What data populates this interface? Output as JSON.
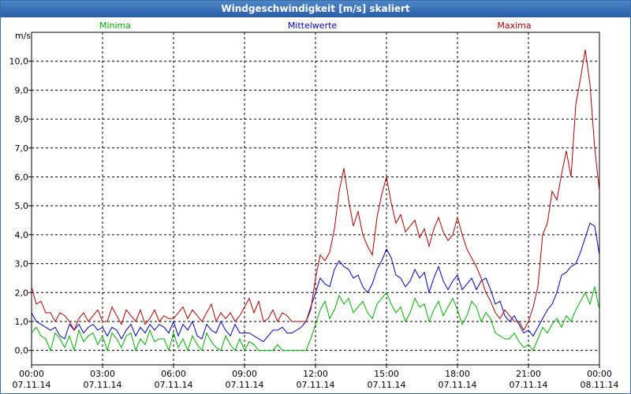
{
  "window": {
    "title": "Windgeschwindigkeit [m/s] skaliert"
  },
  "chart_data": {
    "type": "line",
    "title": "Windgeschwindigkeit [m/s] skaliert",
    "ylabel": "m/s",
    "xlabel": "",
    "ylim": [
      -0.5,
      11.0
    ],
    "xlim": [
      0,
      24
    ],
    "grid": true,
    "legend_placement": "top",
    "y_ticks": [
      "0,0",
      "1,0",
      "2,0",
      "3,0",
      "4,0",
      "5,0",
      "6,0",
      "7,0",
      "8,0",
      "9,0",
      "10,0"
    ],
    "x_ticks": [
      {
        "time": "00:00",
        "date": "07.11.14"
      },
      {
        "time": "03:00",
        "date": "07.11.14"
      },
      {
        "time": "06:00",
        "date": "07.11.14"
      },
      {
        "time": "09:00",
        "date": "07.11.14"
      },
      {
        "time": "12:00",
        "date": "07.11.14"
      },
      {
        "time": "15:00",
        "date": "07.11.14"
      },
      {
        "time": "18:00",
        "date": "07.11.14"
      },
      {
        "time": "21:00",
        "date": "07.11.14"
      },
      {
        "time": "00:00",
        "date": "08.11.14"
      }
    ],
    "x_hours": [
      0.0,
      0.2,
      0.4,
      0.6,
      0.8,
      1.0,
      1.2,
      1.4,
      1.6,
      1.8,
      2.0,
      2.2,
      2.4,
      2.6,
      2.8,
      3.0,
      3.2,
      3.4,
      3.6,
      3.8,
      4.0,
      4.2,
      4.4,
      4.6,
      4.8,
      5.0,
      5.2,
      5.4,
      5.6,
      5.8,
      6.0,
      6.2,
      6.4,
      6.6,
      6.8,
      7.0,
      7.2,
      7.4,
      7.6,
      7.8,
      8.0,
      8.2,
      8.4,
      8.6,
      8.8,
      9.0,
      9.2,
      9.4,
      9.6,
      9.8,
      10.0,
      10.2,
      10.4,
      10.6,
      10.8,
      11.0,
      11.2,
      11.4,
      11.6,
      11.8,
      12.0,
      12.2,
      12.4,
      12.6,
      12.8,
      13.0,
      13.2,
      13.4,
      13.6,
      13.8,
      14.0,
      14.2,
      14.4,
      14.6,
      14.8,
      15.0,
      15.2,
      15.4,
      15.6,
      15.8,
      16.0,
      16.2,
      16.4,
      16.6,
      16.8,
      17.0,
      17.2,
      17.4,
      17.6,
      17.8,
      18.0,
      18.2,
      18.4,
      18.6,
      18.8,
      19.0,
      19.2,
      19.4,
      19.6,
      19.8,
      20.0,
      20.2,
      20.4,
      20.6,
      20.8,
      21.0,
      21.2,
      21.4,
      21.6,
      21.8,
      22.0,
      22.2,
      22.4,
      22.6,
      22.8,
      23.0,
      23.2,
      23.4,
      23.6,
      23.8,
      24.0
    ],
    "series": [
      {
        "name": "Minima",
        "color": "#00b000",
        "values": [
          0.6,
          0.8,
          0.5,
          0.4,
          0.0,
          0.6,
          0.4,
          0.1,
          0.5,
          0.0,
          0.7,
          0.3,
          0.5,
          0.6,
          0.2,
          0.5,
          0.0,
          0.6,
          0.4,
          0.1,
          0.5,
          0.6,
          0.0,
          0.4,
          0.2,
          0.7,
          0.3,
          0.4,
          0.4,
          0.0,
          0.6,
          0.1,
          0.4,
          0.0,
          0.5,
          0.2,
          0.0,
          0.6,
          0.3,
          0.1,
          0.0,
          0.5,
          0.2,
          0.0,
          0.4,
          0.0,
          0.3,
          0.2,
          0.0,
          0.0,
          0.0,
          0.0,
          0.2,
          0.0,
          0.0,
          0.0,
          0.0,
          0.0,
          0.0,
          0.4,
          0.9,
          1.4,
          1.7,
          1.1,
          1.4,
          1.9,
          1.6,
          1.8,
          1.3,
          1.5,
          1.7,
          1.3,
          1.1,
          1.6,
          1.8,
          2.0,
          1.6,
          1.3,
          1.5,
          1.0,
          1.3,
          1.8,
          1.5,
          1.6,
          1.0,
          1.4,
          1.7,
          1.2,
          1.5,
          1.8,
          1.4,
          0.9,
          1.2,
          1.7,
          1.5,
          1.0,
          1.3,
          1.1,
          0.6,
          0.5,
          0.4,
          0.4,
          0.6,
          0.3,
          0.1,
          0.2,
          0.0,
          0.4,
          0.8,
          0.6,
          0.9,
          1.1,
          0.8,
          1.2,
          1.0,
          1.4,
          1.7,
          2.0,
          1.6,
          2.2,
          1.4
        ]
      },
      {
        "name": "Mittelwerte",
        "color": "#0000c0",
        "values": [
          1.3,
          1.0,
          0.9,
          0.8,
          0.7,
          0.8,
          0.5,
          0.4,
          0.9,
          0.7,
          0.9,
          0.6,
          0.8,
          0.9,
          0.7,
          0.8,
          0.5,
          0.8,
          0.7,
          0.4,
          0.7,
          0.9,
          0.5,
          0.8,
          0.6,
          0.9,
          0.7,
          0.9,
          0.8,
          0.6,
          1.0,
          0.5,
          0.9,
          0.7,
          1.0,
          0.5,
          0.4,
          0.9,
          0.7,
          0.6,
          1.0,
          0.7,
          0.5,
          0.9,
          0.6,
          0.6,
          0.6,
          0.5,
          0.4,
          0.3,
          0.5,
          0.7,
          0.7,
          0.8,
          0.6,
          0.6,
          0.7,
          0.8,
          1.0,
          1.5,
          2.0,
          2.5,
          2.3,
          2.2,
          2.8,
          3.1,
          2.9,
          2.8,
          2.5,
          2.6,
          2.2,
          2.0,
          2.3,
          2.8,
          3.1,
          3.5,
          3.2,
          2.6,
          2.5,
          2.2,
          2.4,
          2.8,
          2.5,
          2.7,
          2.0,
          2.5,
          2.9,
          2.4,
          2.1,
          2.4,
          2.6,
          2.1,
          2.3,
          2.5,
          2.1,
          2.4,
          2.5,
          2.1,
          1.6,
          1.7,
          1.2,
          1.0,
          1.2,
          0.9,
          0.6,
          0.7,
          0.5,
          0.8,
          1.1,
          1.4,
          1.6,
          2.0,
          2.6,
          2.7,
          2.9,
          3.0,
          3.4,
          3.9,
          4.4,
          4.3,
          3.3
        ]
      },
      {
        "name": "Maxima",
        "color": "#b00000",
        "values": [
          2.2,
          1.6,
          1.7,
          1.3,
          1.3,
          1.0,
          1.3,
          1.2,
          1.0,
          0.7,
          1.1,
          1.3,
          1.0,
          1.2,
          1.4,
          1.0,
          1.0,
          1.5,
          1.2,
          0.9,
          1.4,
          1.2,
          1.0,
          1.4,
          0.9,
          1.1,
          1.4,
          1.0,
          1.2,
          1.1,
          1.1,
          1.3,
          1.5,
          1.1,
          1.4,
          1.2,
          1.0,
          1.3,
          1.6,
          1.0,
          1.3,
          1.1,
          1.3,
          1.0,
          1.2,
          1.5,
          1.8,
          1.3,
          1.7,
          1.0,
          1.1,
          1.4,
          1.0,
          1.3,
          1.2,
          1.0,
          1.0,
          1.0,
          1.0,
          1.4,
          2.5,
          3.3,
          3.1,
          3.4,
          4.2,
          5.5,
          6.3,
          5.2,
          4.3,
          4.8,
          4.0,
          3.6,
          3.3,
          4.6,
          5.4,
          6.0,
          5.1,
          4.4,
          4.7,
          4.1,
          4.3,
          4.5,
          3.9,
          4.2,
          3.6,
          4.2,
          4.6,
          4.1,
          3.8,
          4.0,
          4.6,
          4.0,
          3.5,
          3.2,
          2.9,
          2.5,
          2.0,
          1.7,
          1.3,
          1.1,
          1.4,
          1.2,
          1.0,
          1.0,
          0.7,
          1.0,
          1.5,
          2.2,
          4.0,
          4.4,
          5.5,
          5.2,
          6.1,
          6.9,
          6.0,
          8.5,
          9.4,
          10.4,
          9.2,
          7.0,
          5.5
        ]
      }
    ]
  }
}
